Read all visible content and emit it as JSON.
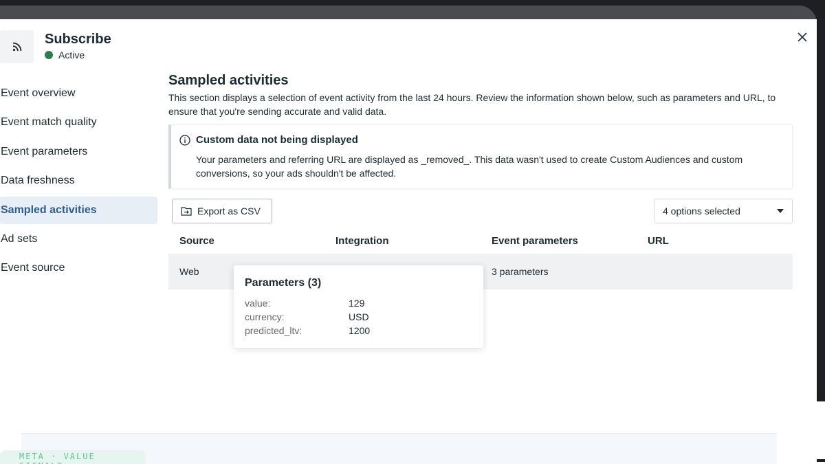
{
  "header": {
    "title": "Subscribe",
    "status": "Active",
    "status_color": "#2e7d4f",
    "icon": "rss-feed-icon"
  },
  "sidebar": {
    "items": [
      {
        "label": "Event overview",
        "active": false
      },
      {
        "label": "Event match quality",
        "active": false
      },
      {
        "label": "Event parameters",
        "active": false
      },
      {
        "label": "Data freshness",
        "active": false
      },
      {
        "label": "Sampled activities",
        "active": true
      },
      {
        "label": "Ad sets",
        "active": false
      },
      {
        "label": "Event source",
        "active": false
      }
    ]
  },
  "main": {
    "title": "Sampled activities",
    "description": "This section displays a selection of event activity from the last 24 hours. Review the information shown below, such as parameters and URL, to ensure that you're sending accurate and valid data.",
    "notice": {
      "title": "Custom data not being displayed",
      "body": "Your parameters and referring URL are displayed as _removed_. This data wasn't used to create Custom Audiences and custom conversions, so your ads shouldn't be affected."
    },
    "export_label": "Export as CSV",
    "filter_value": "4 options selected",
    "table": {
      "headers": [
        "Source",
        "Integration",
        "Event parameters",
        "URL"
      ],
      "rows": [
        {
          "source": "Web",
          "integration": "",
          "parameters": "3 parameters",
          "url": ""
        }
      ]
    },
    "tooltip": {
      "title": "Parameters (3)",
      "params": [
        {
          "key": "value:",
          "value": "129"
        },
        {
          "key": "currency:",
          "value": "USD"
        },
        {
          "key": "predicted_ltv:",
          "value": "1200"
        }
      ]
    }
  },
  "footer": {
    "brand": "META · VALUE SIGNALS"
  },
  "colors": {
    "active_nav_bg": "#e7eef6",
    "active_nav_text": "#2f5d8e",
    "row_bg": "#eff1f3"
  }
}
